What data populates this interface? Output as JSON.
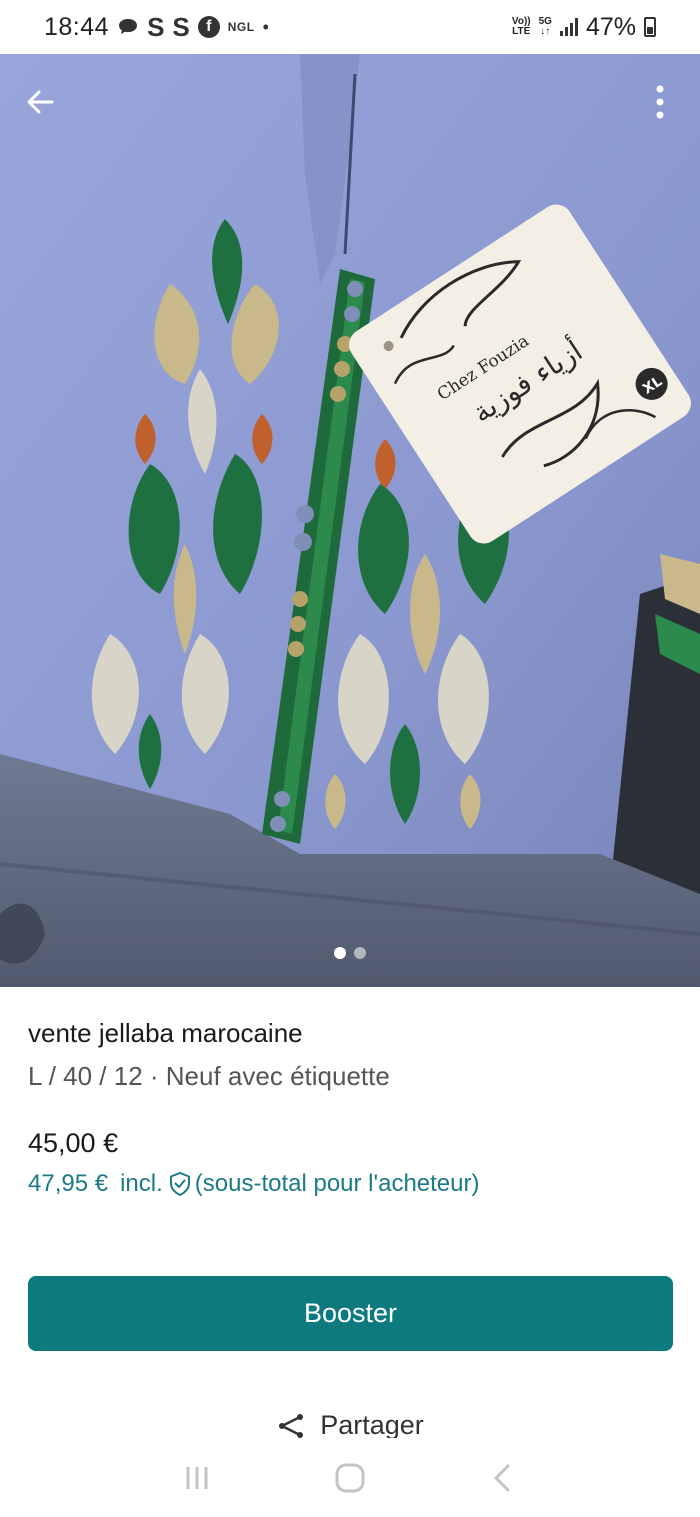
{
  "status_bar": {
    "time": "18:44",
    "icons_left": [
      "chat-icon",
      "s-app-icon",
      "s-app-icon",
      "facebook-icon",
      "ngl-icon",
      "dot"
    ],
    "s_letter": "S",
    "fb_letter": "f",
    "ngl_label": "NGL",
    "volte_top": "Vo))",
    "volte_bottom": "LTE",
    "net_top": "5G",
    "net_bottom": "↓↑",
    "battery": "47%"
  },
  "gallery": {
    "image_count": 2,
    "active_index": 0,
    "tag_text_latin": "Chez Fouzia",
    "tag_text_arabic": "أزياء فوزية",
    "tag_size": "XL"
  },
  "listing": {
    "title": "vente jellaba marocaine",
    "details": "L / 40 / 12 · Neuf avec étiquette",
    "price": "45,00 €",
    "price_incl": "47,95 €",
    "incl_label": "incl.",
    "buyer_note": "(sous-total pour l'acheteur)"
  },
  "actions": {
    "booster_label": "Booster",
    "share_label": "Partager"
  },
  "colors": {
    "accent": "#0d7a80",
    "price_incl": "#1b7a85",
    "fabric": "#8e9bd0"
  }
}
